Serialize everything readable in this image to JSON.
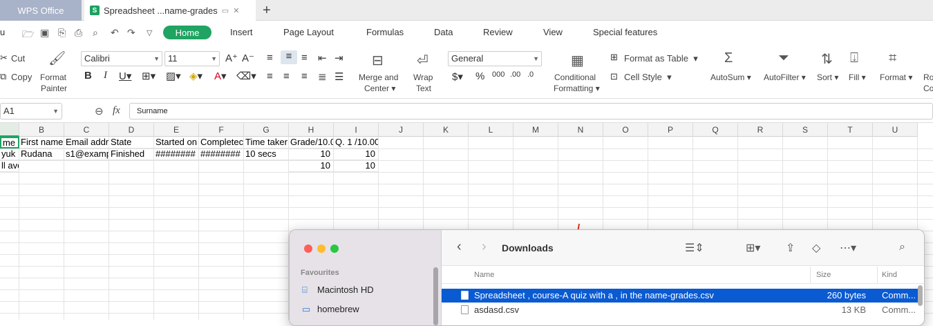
{
  "tabs": {
    "wps": "WPS Office",
    "sheet": "Spreadsheet ...name-grades"
  },
  "menu": {
    "items": [
      "Home",
      "Insert",
      "Page Layout",
      "Formulas",
      "Data",
      "Review",
      "View",
      "Special features"
    ],
    "partial_left": "u"
  },
  "ribbon": {
    "cut": "Cut",
    "copy": "Copy",
    "format_painter_1": "Format",
    "format_painter_2": "Painter",
    "font_name": "Calibri",
    "font_size": "11",
    "merge_1": "Merge and",
    "merge_2": "Center",
    "wrap_1": "Wrap",
    "wrap_2": "Text",
    "number_format": "General",
    "cond_1": "Conditional",
    "cond_2": "Formatting",
    "format_table": "Format as Table",
    "cell_style": "Cell Style",
    "autosum": "AutoSum",
    "autofilter": "AutoFilter",
    "sort": "Sort",
    "fill": "Fill",
    "format": "Format",
    "partial_right_1": "Ro",
    "partial_right_2": "Co"
  },
  "formula_bar": {
    "cell_ref": "A1",
    "fx": "fx",
    "content": "Surname"
  },
  "sheet": {
    "columns": [
      "",
      "B",
      "C",
      "D",
      "E",
      "F",
      "G",
      "H",
      "I",
      "J",
      "K",
      "L",
      "M",
      "N",
      "O",
      "P",
      "Q",
      "R",
      "S",
      "T",
      "U"
    ],
    "rows": [
      [
        "me",
        "First name",
        "Email addr",
        "State",
        "Started on",
        "Completec",
        "Time taker",
        "Grade/10.0",
        "Q. 1 /10.00"
      ],
      [
        "yuk",
        "Rudana",
        "s1@examp",
        "Finished",
        "########",
        "########",
        "10 secs",
        "10",
        "10"
      ],
      [
        "ll average",
        "",
        "",
        "",
        "",
        "",
        "",
        "10",
        "10"
      ]
    ]
  },
  "finder": {
    "title": "Downloads",
    "sidebar_heading": "Favourites",
    "sidebar_items": [
      "Macintosh HD",
      "homebrew"
    ],
    "columns": {
      "name": "Name",
      "size": "Size",
      "kind": "Kind"
    },
    "files": [
      {
        "name": "Spreadsheet , course-A quiz with a , in the name-grades.csv",
        "size": "260 bytes",
        "kind": "Comm..."
      },
      {
        "name": "asdasd.csv",
        "size": "13 KB",
        "kind": "Comm..."
      }
    ],
    "accent": "#0a5ad1"
  },
  "annotation_color": "#e2321e"
}
